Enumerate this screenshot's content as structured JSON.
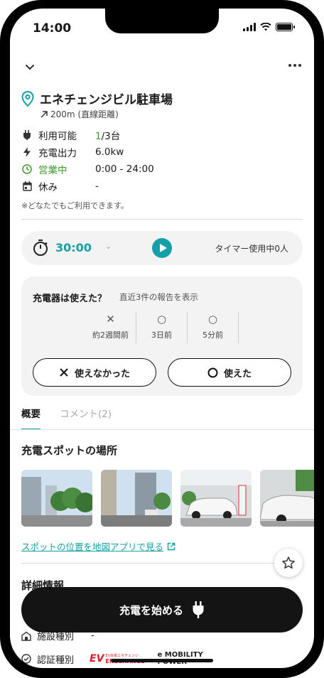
{
  "status_bar": {
    "time": "14:00"
  },
  "spot": {
    "name": "エネチェンジビル駐車場",
    "distance": "200m (直線距離)"
  },
  "info": {
    "availability_label": "利用可能",
    "availability_available": "1",
    "availability_total": "/3台",
    "output_label": "充電出力",
    "output_value": "6.0kw",
    "status_label": "営業中",
    "hours_value": "0:00 - 24:00",
    "holiday_label": "休み",
    "holiday_value": "-",
    "note": "※どなたでもご利用できます。"
  },
  "timer": {
    "value": "30:00",
    "users": "タイマー使用中0人"
  },
  "report": {
    "question": "充電器は使えた？",
    "sub": "直近3件の報告を表示",
    "items": [
      {
        "mark": "✕",
        "when": "約2週間前"
      },
      {
        "mark": "○",
        "when": "3日前"
      },
      {
        "mark": "○",
        "when": "5分前"
      }
    ],
    "not_usable_label": "使えなかった",
    "usable_label": "使えた"
  },
  "tabs": {
    "overview": "概要",
    "comments": "コメント(2)"
  },
  "location": {
    "title": "充電スポットの場所",
    "map_link": "スポットの位置を地図アプリで見る"
  },
  "details": {
    "title": "詳細情報",
    "facility_label": "施設種別",
    "facility_value": "-",
    "cert_label": "認証種別",
    "logo_evchange_small": "EV充電エネチェンジ",
    "logo_evchange_ev": "EV",
    "logo_evchange_name": "ENECHANGE",
    "logo_mobility": "e MOBILITY POWER"
  },
  "cta": {
    "start_label": "充電を始める"
  },
  "colors": {
    "accent": "#13a0a6",
    "green": "#3d9a2a",
    "button_dark": "#141414"
  }
}
